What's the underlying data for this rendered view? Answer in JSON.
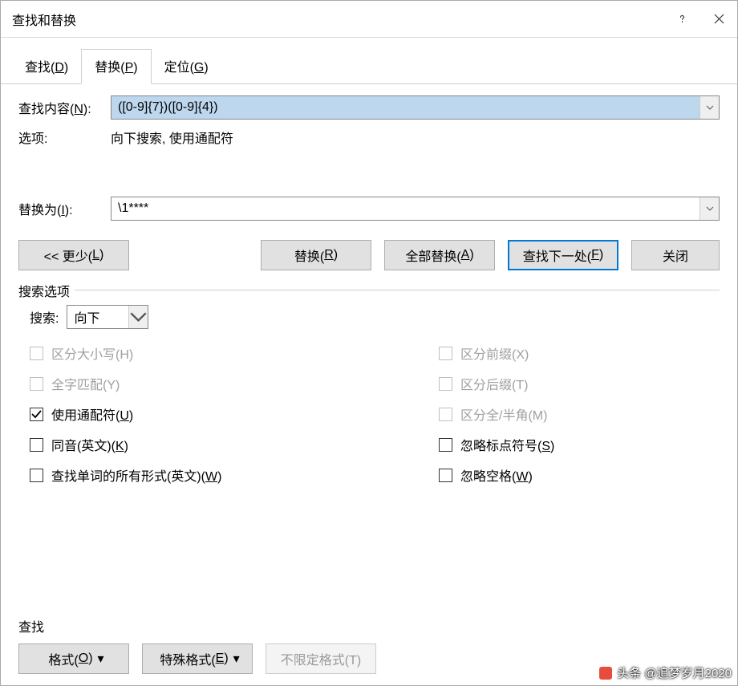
{
  "title": "查找和替换",
  "tabs": {
    "find": "查找(D)",
    "replace": "替换(P)",
    "goto": "定位(G)"
  },
  "labels": {
    "findwhat": "查找内容(N):",
    "options": "选项:",
    "replacewith": "替换为(I):",
    "searchopts": "搜索选项",
    "search": "搜索:",
    "findsection": "查找"
  },
  "values": {
    "findwhat": "([0-9]{7})([0-9]{4})",
    "options": "向下搜索, 使用通配符",
    "replacewith": "\\1****",
    "direction": "向下"
  },
  "buttons": {
    "less": "<< 更少(L)",
    "replace": "替换(R)",
    "replaceall": "全部替换(A)",
    "findnext": "查找下一处(F)",
    "close": "关闭",
    "format": "格式(O)",
    "special": "特殊格式(E)",
    "noformat": "不限定格式(T)"
  },
  "checks": {
    "matchcase": "区分大小写(H)",
    "wholeword": "全字匹配(Y)",
    "wildcards": "使用通配符(U)",
    "soundslike": "同音(英文)(K)",
    "allforms": "查找单词的所有形式(英文)(W)",
    "prefix": "区分前缀(X)",
    "suffix": "区分后缀(T)",
    "fullhalf": "区分全/半角(M)",
    "ignorepunct": "忽略标点符号(S)",
    "ignorespace": "忽略空格(W)"
  },
  "watermark": "头条 @追梦岁月2020"
}
